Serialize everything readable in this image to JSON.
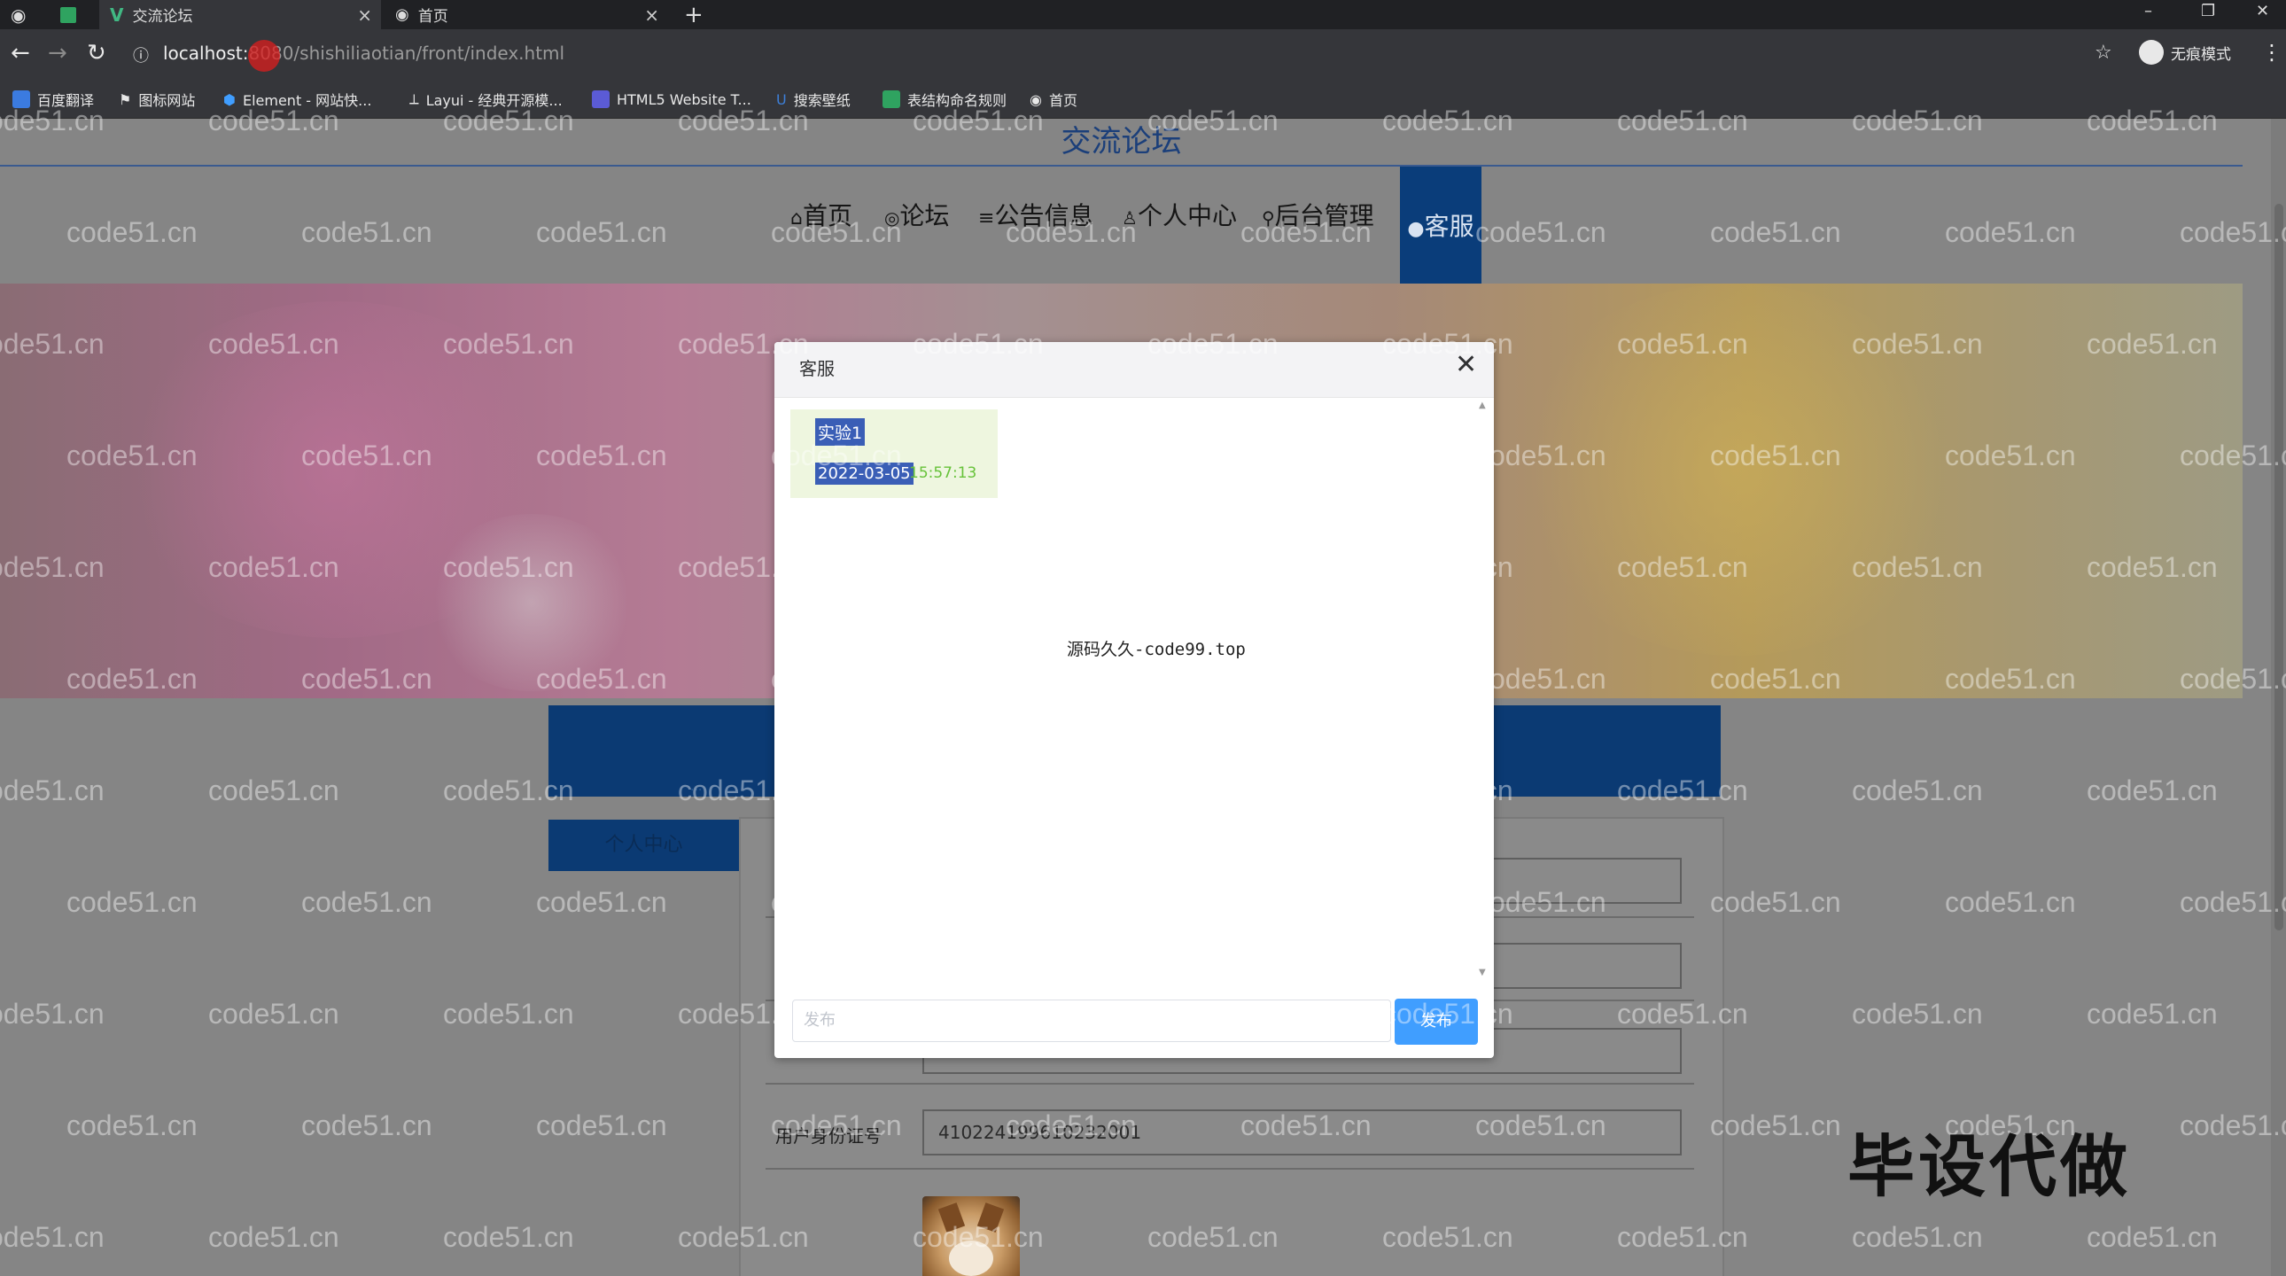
{
  "browser": {
    "tabs": [
      {
        "label": ""
      },
      {
        "label": ""
      },
      {
        "label": "交流论坛"
      },
      {
        "label": "首页"
      }
    ],
    "new_tab": "+",
    "window_controls": {
      "minimize": "–",
      "restore": "❐",
      "close": "✕"
    },
    "address": {
      "host": "localhost:",
      "port": "8080",
      "path": "/shishiliaotian/front/index.html"
    },
    "profile_label": "无痕模式",
    "bookmarks": [
      {
        "label": "百度翻译",
        "icon": "baidu-translate-icon",
        "color": "#3b7be0"
      },
      {
        "label": "图标网站",
        "icon": "flag-icon",
        "color": "#e8e8e8"
      },
      {
        "label": "Element - 网站快...",
        "icon": "element-icon",
        "color": "#409eff"
      },
      {
        "label": "Layui - 经典开源模...",
        "icon": "layui-icon",
        "color": "#bdbdbd"
      },
      {
        "label": "HTML5 Website T...",
        "icon": "html5-icon",
        "color": "#5b5bd6"
      },
      {
        "label": "搜索壁纸",
        "icon": "wallpaper-icon",
        "color": "#3d7fd8"
      },
      {
        "label": "表结构命名规则",
        "icon": "sheet-icon",
        "color": "#2fa360"
      },
      {
        "label": "首页",
        "icon": "globe-icon",
        "color": "#e8e8e8"
      }
    ]
  },
  "site": {
    "title": "交流论坛",
    "nav": [
      {
        "label": "首页",
        "icon": "home-icon",
        "glyph": "⌂"
      },
      {
        "label": "论坛",
        "icon": "forum-icon",
        "glyph": "◎"
      },
      {
        "label": "公告信息",
        "icon": "notice-icon",
        "glyph": "≡"
      },
      {
        "label": "个人中心",
        "icon": "user-icon",
        "glyph": "♙"
      },
      {
        "label": "后台管理",
        "icon": "link-icon",
        "glyph": "⚲"
      },
      {
        "label": "客服",
        "icon": "service-icon",
        "glyph": "●"
      }
    ],
    "sidebar_button": "个人中心",
    "bluebar_text": "...",
    "form": {
      "id_label": "用户身份证号",
      "id_value": "410224199610232001"
    }
  },
  "dialog": {
    "title": "客服",
    "close": "✕",
    "message": {
      "name": "实验1",
      "date": "2022-03-05",
      "time": "15:57:13"
    },
    "center_text": "源码久久-code99.top",
    "input_placeholder": "发布",
    "send_label": "发布"
  },
  "watermark": "code51.cn",
  "overlay_text": "毕设代做",
  "colors": {
    "nav_active": "#0a3d7a",
    "send_button": "#409eff",
    "message_time": "#67c23a"
  }
}
